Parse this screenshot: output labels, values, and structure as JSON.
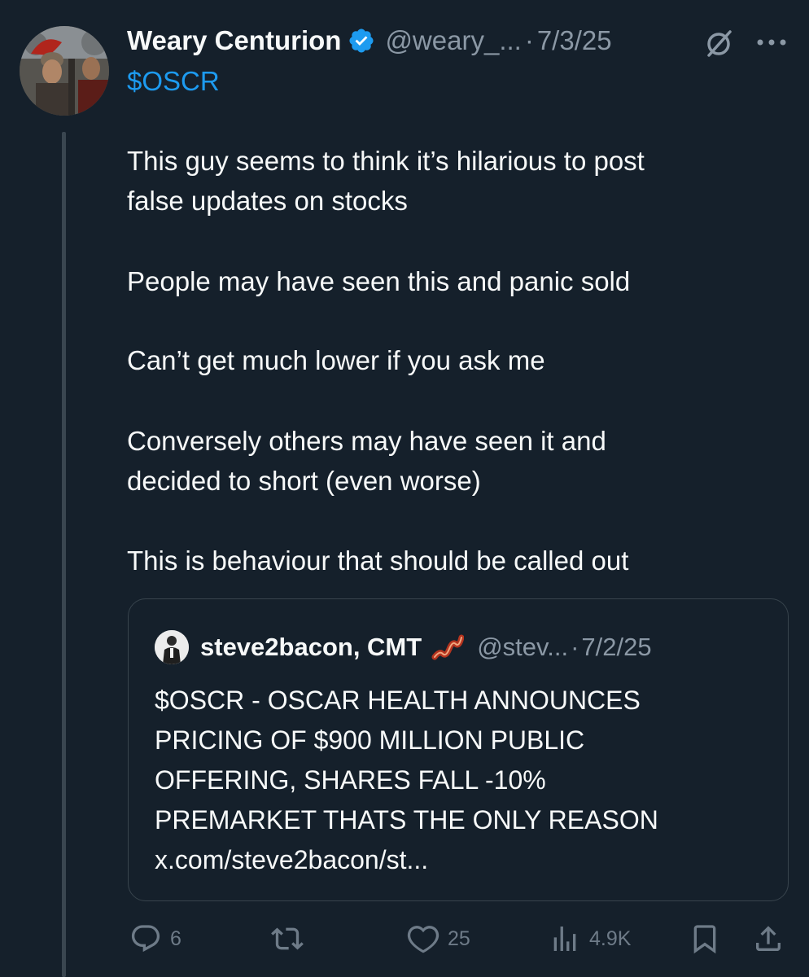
{
  "tweet": {
    "author_name": "Weary Centurion",
    "handle": "@weary_...",
    "separator": "·",
    "date": "7/3/25",
    "cashtag": "$OSCR",
    "paragraphs": [
      [
        "This guy seems to think it’s hilarious to post",
        "false updates on stocks"
      ],
      [
        "People may have seen this and panic sold"
      ],
      [
        "Can’t get much lower if you ask me"
      ],
      [
        "Conversely others may have seen it and",
        "decided to short (even worse)"
      ],
      [
        "This is behaviour that should be called out"
      ]
    ]
  },
  "quoted_tweet": {
    "author_name": "steve2bacon, CMT",
    "handle": "@stev...",
    "separator": "·",
    "date": "7/2/25",
    "body_lines": [
      "$OSCR - OSCAR HEALTH ANNOUNCES",
      "PRICING OF $900 MILLION PUBLIC",
      "OFFERING, SHARES FALL -10%",
      "PREMARKET THATS THE ONLY REASON",
      "x.com/steve2bacon/st..."
    ]
  },
  "actions": {
    "reply_count": "6",
    "repost_count": "",
    "like_count": "25",
    "view_count": "4.9K"
  },
  "icons": {
    "verified": "verified-badge-icon",
    "grok": "grok-icon",
    "more": "more-icon",
    "bacon": "bacon-emoji-icon",
    "reply": "reply-icon",
    "repost": "repost-icon",
    "like": "like-icon",
    "views": "views-icon",
    "bookmark": "bookmark-icon",
    "share": "share-icon"
  },
  "colors": {
    "background": "#15202b",
    "text_primary": "#f7f9f9",
    "text_secondary": "#8b98a5",
    "accent": "#1d9bf0",
    "border": "#38444d"
  }
}
